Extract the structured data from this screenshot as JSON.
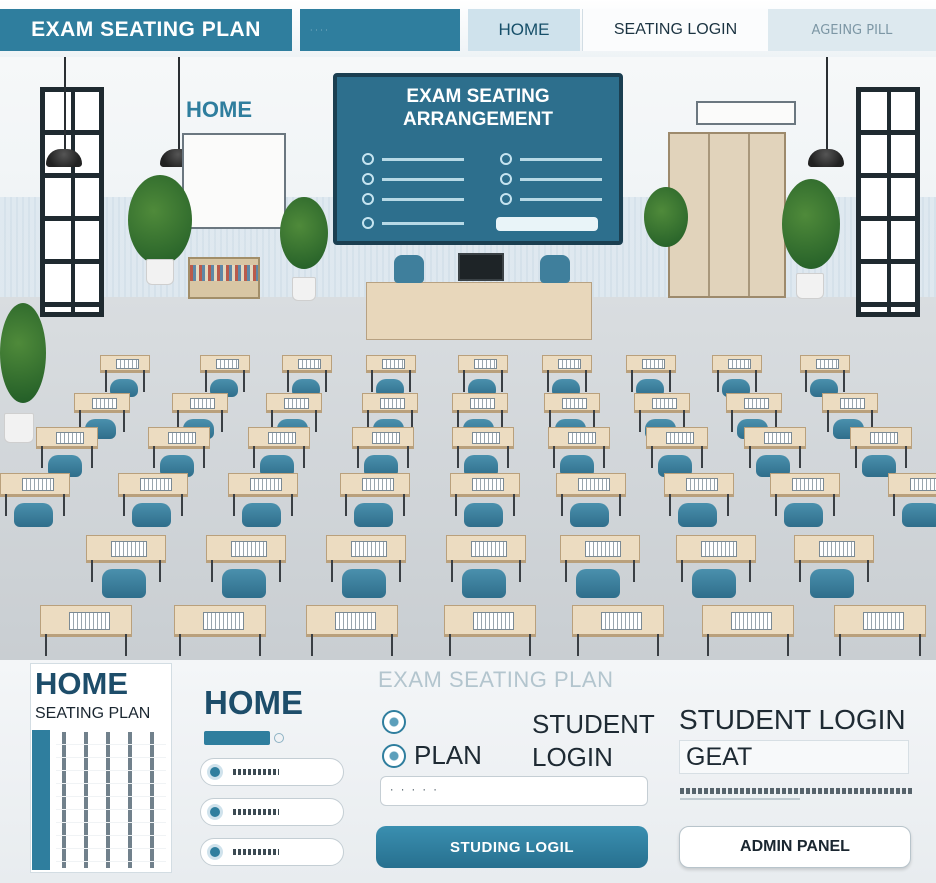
{
  "nav": {
    "brand": "EXAM SEATING PLAN",
    "home": "HOME",
    "seating_login": "SEATING LOGIN",
    "extra": "AGEING PILL"
  },
  "scene": {
    "wall_label": "HOME",
    "board_title": "EXAM SEATING ARRANGEMENT"
  },
  "panel": {
    "title": "EXAM SEATING PLAN",
    "mini_card": {
      "title": "HOME",
      "subtitle": "SEATING PLAN"
    },
    "home_heading": "HOME",
    "plan_label": "PLAN",
    "student_label": "STUDENT LOGIN",
    "student_login_title": "STUDENT LOGIN",
    "gate_value": "GEAT",
    "primary_button": "STUDING LOGIL",
    "admin_button": "ADMIN PANEL"
  },
  "colors": {
    "accent": "#2f7e9e",
    "accent_dark": "#1d4d6a",
    "panel_bg": "#f4f6f8"
  }
}
